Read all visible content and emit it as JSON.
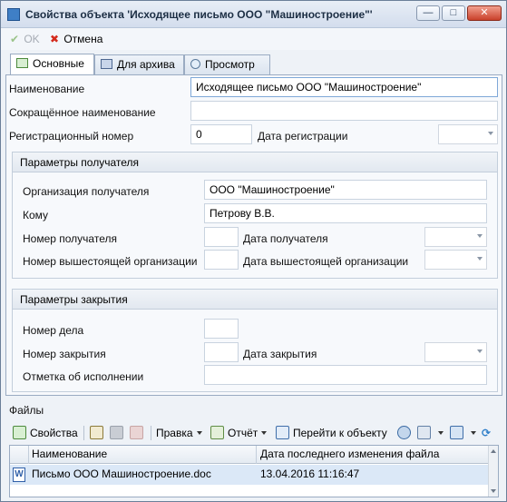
{
  "window": {
    "title": "Свойства объекта 'Исходящее письмо ООО \"Машиностроение\"'",
    "minimize": "—",
    "maximize": "□",
    "close": "✕"
  },
  "toolbar": {
    "ok_label": "OK",
    "cancel_label": "Отмена"
  },
  "tabs": [
    {
      "label": "Основные",
      "active": true
    },
    {
      "label": "Для архива",
      "active": false
    },
    {
      "label": "Просмотр",
      "active": false
    }
  ],
  "main": {
    "name_label": "Наименование",
    "name_value": "Исходящее письмо ООО \"Машиностроение\"",
    "short_name_label": "Сокращённое наименование",
    "short_name_value": "",
    "reg_number_label": "Регистрационный номер",
    "reg_number_value": "0",
    "reg_date_label": "Дата регистрации",
    "reg_date_value": ""
  },
  "recipient": {
    "header": "Параметры получателя",
    "org_label": "Организация получателя",
    "org_value": "ООО \"Машиностроение\"",
    "to_label": "Кому",
    "to_value": "Петрову В.В.",
    "recipient_number_label": "Номер получателя",
    "recipient_number_value": "",
    "recipient_date_label": "Дата получателя",
    "recipient_date_value": "",
    "superior_number_label": "Номер вышестоящей организации",
    "superior_number_value": "",
    "superior_date_label": "Дата вышестоящей организации",
    "superior_date_value": ""
  },
  "closing": {
    "header": "Параметры закрытия",
    "case_number_label": "Номер дела",
    "case_number_value": "",
    "closing_number_label": "Номер закрытия",
    "closing_number_value": "",
    "closing_date_label": "Дата закрытия",
    "closing_date_value": "",
    "execution_mark_label": "Отметка об исполнении",
    "execution_mark_value": ""
  },
  "files": {
    "label": "Файлы",
    "toolbar": {
      "properties": "Свойства",
      "edit": "Правка",
      "report": "Отчёт",
      "goto": "Перейти к объекту"
    },
    "columns": [
      "Наименование",
      "Дата последнего изменения файла"
    ],
    "rows": [
      {
        "name": "Письмо ООО Машиностроение.doc",
        "modified": "13.04.2016 11:16:47"
      }
    ]
  },
  "colors": {
    "accent": "#3f7fc6",
    "selection": "#dbe8f7",
    "cancel_red": "#d42a1c",
    "ok_green": "#9bc48a"
  }
}
